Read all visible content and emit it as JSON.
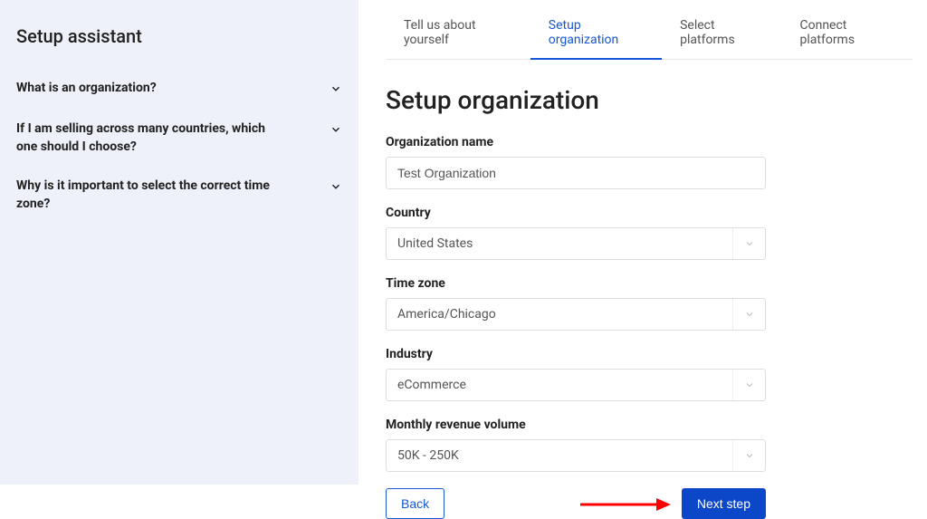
{
  "sidebar": {
    "title": "Setup assistant",
    "faq": [
      {
        "q": "What is an organization?"
      },
      {
        "q": "If I am selling across many countries, which one should I choose?"
      },
      {
        "q": "Why is it important to select the correct time zone?"
      }
    ]
  },
  "tabs": [
    {
      "label": "Tell us about yourself",
      "active": false
    },
    {
      "label": "Setup organization",
      "active": true
    },
    {
      "label": "Select platforms",
      "active": false
    },
    {
      "label": "Connect platforms",
      "active": false
    }
  ],
  "page_title": "Setup organization",
  "form": {
    "org_name": {
      "label": "Organization name",
      "value": "Test Organization"
    },
    "country": {
      "label": "Country",
      "value": "United States"
    },
    "timezone": {
      "label": "Time zone",
      "value": "America/Chicago"
    },
    "industry": {
      "label": "Industry",
      "value": "eCommerce"
    },
    "revenue": {
      "label": "Monthly revenue volume",
      "value": "50K - 250K"
    }
  },
  "buttons": {
    "back": "Back",
    "next": "Next step"
  },
  "colors": {
    "accent": "#1557d6",
    "sidebar_bg": "#eef1f9",
    "annotation": "#ff0000"
  }
}
